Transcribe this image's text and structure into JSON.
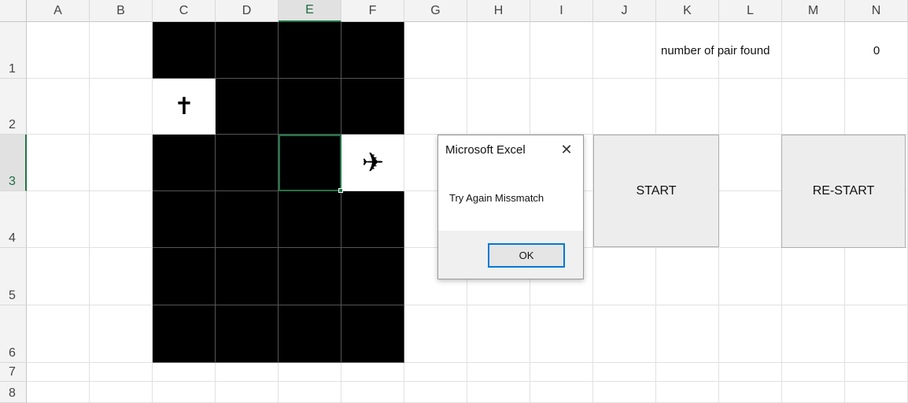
{
  "columns": [
    "A",
    "B",
    "C",
    "D",
    "E",
    "F",
    "G",
    "H",
    "I",
    "J",
    "K",
    "L",
    "M",
    "N"
  ],
  "rows": [
    "1",
    "2",
    "3",
    "4",
    "5",
    "6",
    "7",
    "8"
  ],
  "selected_column": "E",
  "selected_row": "3",
  "cells": {
    "C2_symbol": "✝",
    "F3_symbol": "✈",
    "pairs_label": "number of pair found",
    "pairs_value": "0"
  },
  "buttons": {
    "start": "START",
    "restart": "RE-START"
  },
  "dialog": {
    "title": "Microsoft Excel",
    "close_icon": "✕",
    "message": "Try Again Missmatch",
    "ok": "OK"
  },
  "colors": {
    "selection_green": "#217346",
    "card_back": "#000000",
    "dialog_accent": "#0078d7"
  }
}
